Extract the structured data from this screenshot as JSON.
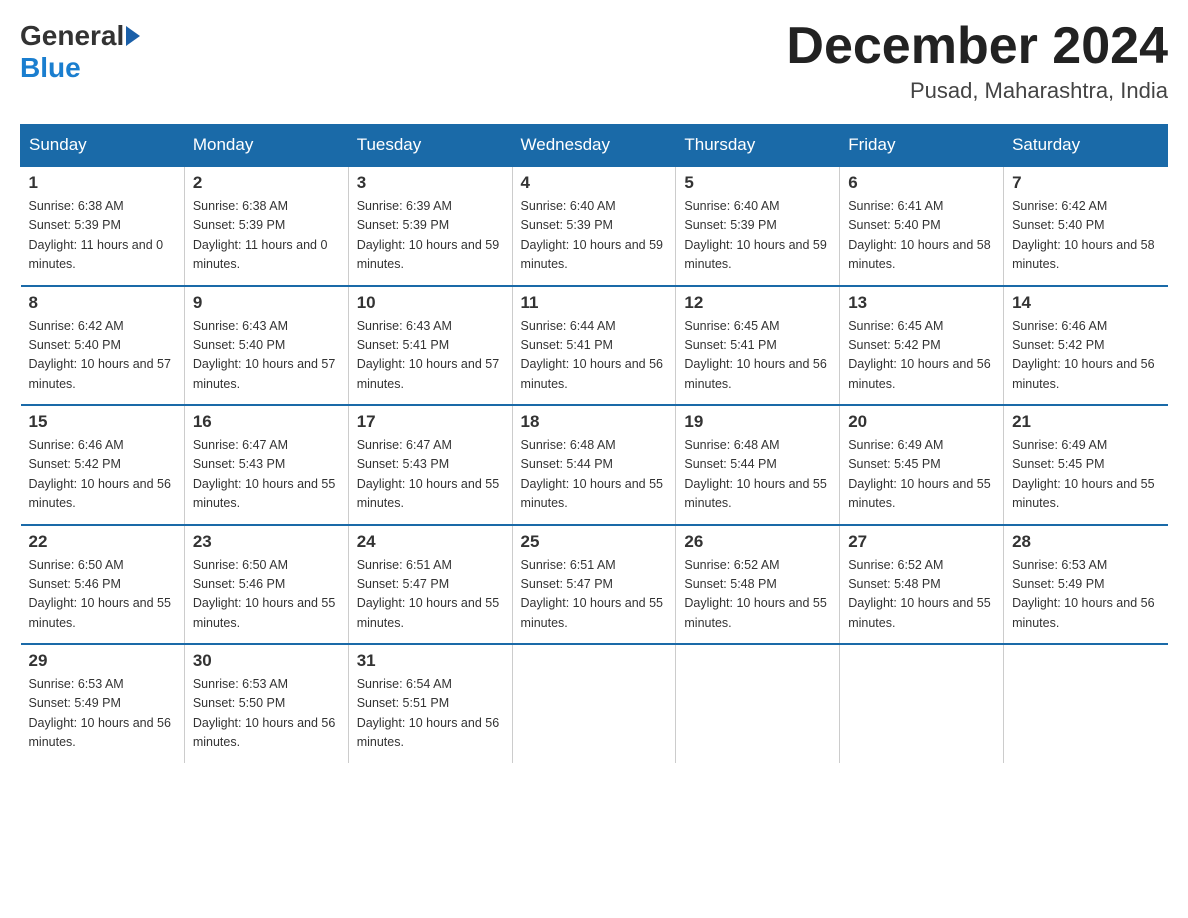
{
  "header": {
    "logo_general": "General",
    "logo_blue": "Blue",
    "month_title": "December 2024",
    "location": "Pusad, Maharashtra, India"
  },
  "days_of_week": [
    "Sunday",
    "Monday",
    "Tuesday",
    "Wednesday",
    "Thursday",
    "Friday",
    "Saturday"
  ],
  "weeks": [
    [
      {
        "day": "1",
        "sunrise": "6:38 AM",
        "sunset": "5:39 PM",
        "daylight": "11 hours and 0 minutes."
      },
      {
        "day": "2",
        "sunrise": "6:38 AM",
        "sunset": "5:39 PM",
        "daylight": "11 hours and 0 minutes."
      },
      {
        "day": "3",
        "sunrise": "6:39 AM",
        "sunset": "5:39 PM",
        "daylight": "10 hours and 59 minutes."
      },
      {
        "day": "4",
        "sunrise": "6:40 AM",
        "sunset": "5:39 PM",
        "daylight": "10 hours and 59 minutes."
      },
      {
        "day": "5",
        "sunrise": "6:40 AM",
        "sunset": "5:39 PM",
        "daylight": "10 hours and 59 minutes."
      },
      {
        "day": "6",
        "sunrise": "6:41 AM",
        "sunset": "5:40 PM",
        "daylight": "10 hours and 58 minutes."
      },
      {
        "day": "7",
        "sunrise": "6:42 AM",
        "sunset": "5:40 PM",
        "daylight": "10 hours and 58 minutes."
      }
    ],
    [
      {
        "day": "8",
        "sunrise": "6:42 AM",
        "sunset": "5:40 PM",
        "daylight": "10 hours and 57 minutes."
      },
      {
        "day": "9",
        "sunrise": "6:43 AM",
        "sunset": "5:40 PM",
        "daylight": "10 hours and 57 minutes."
      },
      {
        "day": "10",
        "sunrise": "6:43 AM",
        "sunset": "5:41 PM",
        "daylight": "10 hours and 57 minutes."
      },
      {
        "day": "11",
        "sunrise": "6:44 AM",
        "sunset": "5:41 PM",
        "daylight": "10 hours and 56 minutes."
      },
      {
        "day": "12",
        "sunrise": "6:45 AM",
        "sunset": "5:41 PM",
        "daylight": "10 hours and 56 minutes."
      },
      {
        "day": "13",
        "sunrise": "6:45 AM",
        "sunset": "5:42 PM",
        "daylight": "10 hours and 56 minutes."
      },
      {
        "day": "14",
        "sunrise": "6:46 AM",
        "sunset": "5:42 PM",
        "daylight": "10 hours and 56 minutes."
      }
    ],
    [
      {
        "day": "15",
        "sunrise": "6:46 AM",
        "sunset": "5:42 PM",
        "daylight": "10 hours and 56 minutes."
      },
      {
        "day": "16",
        "sunrise": "6:47 AM",
        "sunset": "5:43 PM",
        "daylight": "10 hours and 55 minutes."
      },
      {
        "day": "17",
        "sunrise": "6:47 AM",
        "sunset": "5:43 PM",
        "daylight": "10 hours and 55 minutes."
      },
      {
        "day": "18",
        "sunrise": "6:48 AM",
        "sunset": "5:44 PM",
        "daylight": "10 hours and 55 minutes."
      },
      {
        "day": "19",
        "sunrise": "6:48 AM",
        "sunset": "5:44 PM",
        "daylight": "10 hours and 55 minutes."
      },
      {
        "day": "20",
        "sunrise": "6:49 AM",
        "sunset": "5:45 PM",
        "daylight": "10 hours and 55 minutes."
      },
      {
        "day": "21",
        "sunrise": "6:49 AM",
        "sunset": "5:45 PM",
        "daylight": "10 hours and 55 minutes."
      }
    ],
    [
      {
        "day": "22",
        "sunrise": "6:50 AM",
        "sunset": "5:46 PM",
        "daylight": "10 hours and 55 minutes."
      },
      {
        "day": "23",
        "sunrise": "6:50 AM",
        "sunset": "5:46 PM",
        "daylight": "10 hours and 55 minutes."
      },
      {
        "day": "24",
        "sunrise": "6:51 AM",
        "sunset": "5:47 PM",
        "daylight": "10 hours and 55 minutes."
      },
      {
        "day": "25",
        "sunrise": "6:51 AM",
        "sunset": "5:47 PM",
        "daylight": "10 hours and 55 minutes."
      },
      {
        "day": "26",
        "sunrise": "6:52 AM",
        "sunset": "5:48 PM",
        "daylight": "10 hours and 55 minutes."
      },
      {
        "day": "27",
        "sunrise": "6:52 AM",
        "sunset": "5:48 PM",
        "daylight": "10 hours and 55 minutes."
      },
      {
        "day": "28",
        "sunrise": "6:53 AM",
        "sunset": "5:49 PM",
        "daylight": "10 hours and 56 minutes."
      }
    ],
    [
      {
        "day": "29",
        "sunrise": "6:53 AM",
        "sunset": "5:49 PM",
        "daylight": "10 hours and 56 minutes."
      },
      {
        "day": "30",
        "sunrise": "6:53 AM",
        "sunset": "5:50 PM",
        "daylight": "10 hours and 56 minutes."
      },
      {
        "day": "31",
        "sunrise": "6:54 AM",
        "sunset": "5:51 PM",
        "daylight": "10 hours and 56 minutes."
      },
      null,
      null,
      null,
      null
    ]
  ],
  "labels": {
    "sunrise": "Sunrise:",
    "sunset": "Sunset:",
    "daylight": "Daylight:"
  }
}
